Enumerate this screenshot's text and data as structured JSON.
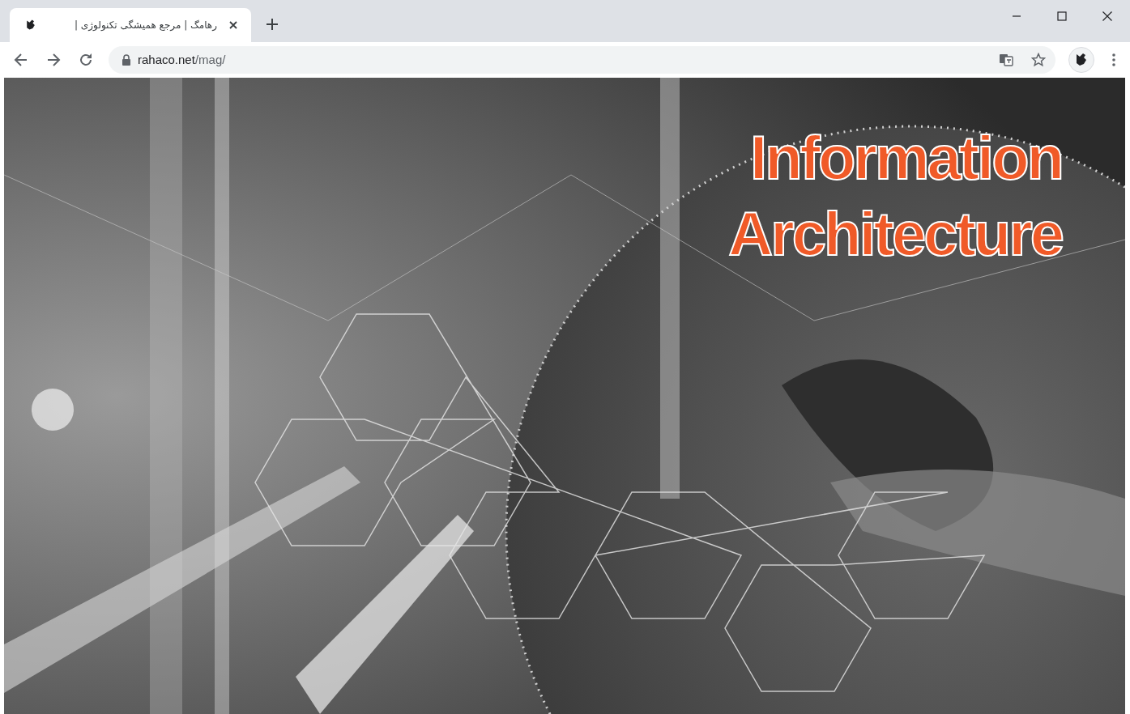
{
  "tabs": [
    {
      "title": "رهامگ | مرجع همیشگی تکنولوژی |",
      "selected": true
    }
  ],
  "address_bar": {
    "host": "rahaco.net",
    "path": "/mag/"
  },
  "page": {
    "banner": {
      "kind": "picture",
      "heading_lines": [
        "Information",
        "Architecture"
      ]
    }
  }
}
